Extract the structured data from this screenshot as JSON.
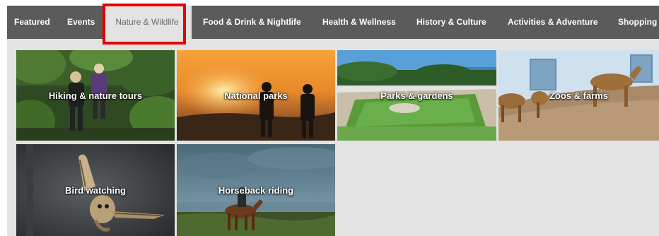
{
  "nav": {
    "tabs": [
      {
        "label": "Featured"
      },
      {
        "label": "Events"
      },
      {
        "label": "Nature & Wildlife"
      },
      {
        "label": "Food & Drink & Nightlife"
      },
      {
        "label": "Health & Wellness"
      },
      {
        "label": "History & Culture"
      },
      {
        "label": "Activities & Adventure"
      },
      {
        "label": "Shopping"
      }
    ],
    "active_tab": "Nature & Wildlife"
  },
  "tiles": [
    {
      "label": "Hiking & nature tours",
      "icon": "hikers-in-forest-image"
    },
    {
      "label": "National parks",
      "icon": "sunset-silhouettes-image"
    },
    {
      "label": "Parks & gardens",
      "icon": "formal-garden-image"
    },
    {
      "label": "Zoos & farms",
      "icon": "goats-image"
    },
    {
      "label": "Bird watching",
      "icon": "owl-in-flight-image"
    },
    {
      "label": "Horseback riding",
      "icon": "rider-on-beach-image"
    }
  ],
  "colors": {
    "nav_background": "#5b5b5b",
    "active_tab_background": "#e3e3e3",
    "highlight_border": "#e60000",
    "content_background": "#e3e3e3"
  }
}
